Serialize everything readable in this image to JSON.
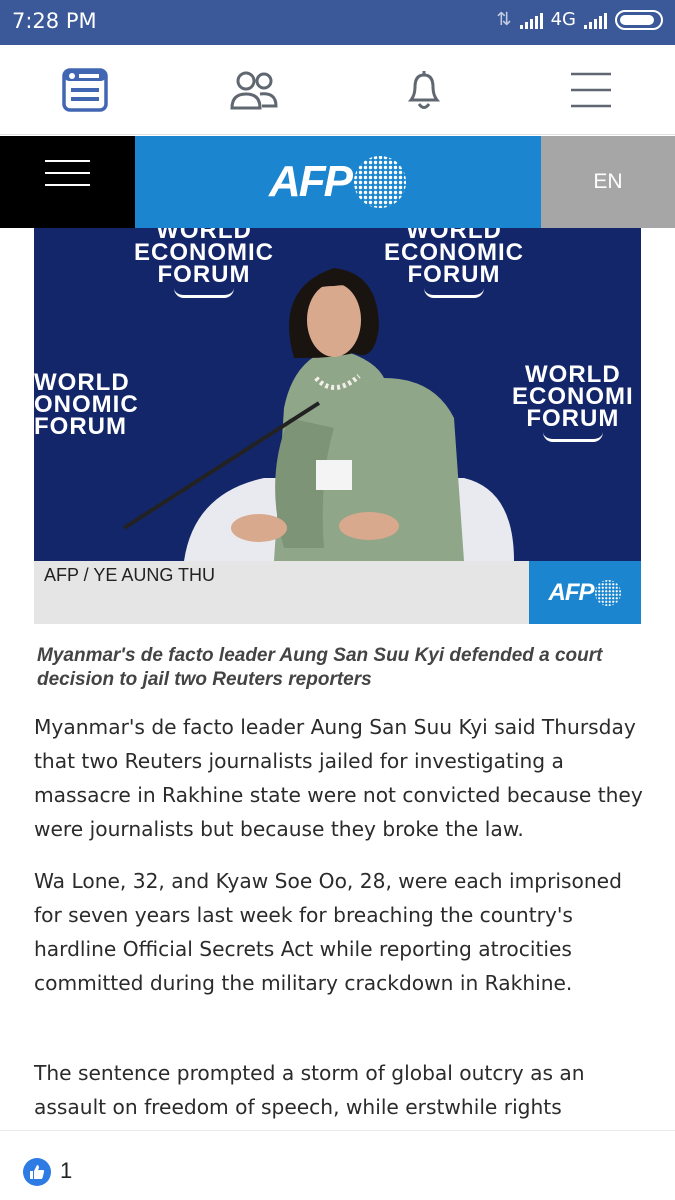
{
  "status_bar": {
    "time": "7:28 PM",
    "network": "4G"
  },
  "fb_nav": {
    "items": [
      "news-feed",
      "friends",
      "notifications",
      "menu"
    ],
    "active_color": "#4267b2",
    "inactive_color": "#606770"
  },
  "afp_header": {
    "logo_text": "AFP",
    "language": "EN"
  },
  "photo": {
    "credit": "AFP / YE AUNG THU",
    "credit_logo": "AFP",
    "backdrop_text_left": [
      "WORLD",
      "ECONOMIC",
      "FORUM"
    ],
    "backdrop_text_center": [
      "WORLD",
      "ECONOMIC",
      "FORUM"
    ],
    "backdrop_text_side_left": [
      "WORLD",
      "ONOMIC",
      "FORUM"
    ],
    "backdrop_text_side_right": [
      "WORLD",
      "ECONOMI",
      "FORUM"
    ]
  },
  "article": {
    "caption": "Myanmar's de facto leader Aung San Suu Kyi defended a court decision to jail two Reuters reporters",
    "paragraphs": [
      "Myanmar's de facto leader Aung San Suu Kyi said Thursday that two Reuters journalists jailed for investigating a massacre in Rakhine state were not convicted because they were journalists but because they broke the law.",
      "Wa Lone, 32, and Kyaw Soe Oo, 28, were each imprisoned for seven years last week for breaching the country's hardline Official Secrets Act while reporting atrocities committed during the military crackdown in Rakhine.",
      "The sentence prompted a storm of global outcry as an assault on freedom of speech, while erstwhile rights"
    ]
  },
  "reactions": {
    "like_count": "1"
  },
  "colors": {
    "status_bar": "#3b5998",
    "afp_blue": "#1b86cf",
    "like_blue": "#2e7be4"
  }
}
